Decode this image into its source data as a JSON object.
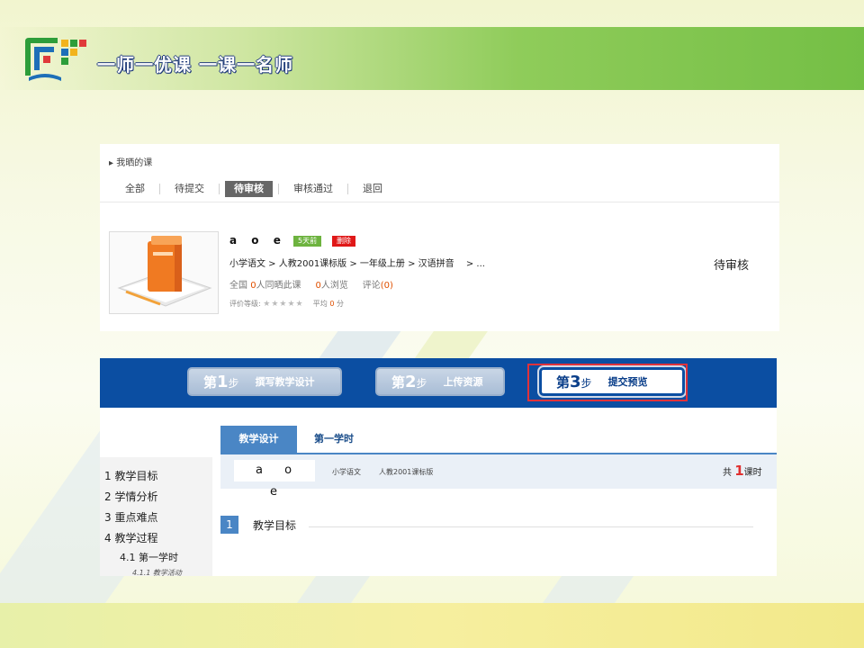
{
  "brand": {
    "title": "一师一优课 一课一名师"
  },
  "my_courses": {
    "title": "▸ 我晒的课",
    "tabs": [
      {
        "label": "全部"
      },
      {
        "label": "待提交"
      },
      {
        "label": "待审核"
      },
      {
        "label": "审核通过"
      },
      {
        "label": "退回"
      }
    ],
    "active_tab": "待审核",
    "course": {
      "name": "a o e",
      "badge_time": "5天前",
      "badge_delete": "删除",
      "path": "小学语文 > 人教2001课标版 > 一年级上册 > 汉语拼音　 > ...",
      "stats_prefix": "全国",
      "stats_count": "0",
      "stats_label": "人同晒此课",
      "views_count": "0",
      "views_label": "人浏览",
      "comments_label": "评论",
      "comments_count": "(0)",
      "rating_label": "评价等级:",
      "stars": "★★★★★",
      "avg_label": "平均",
      "avg_value": "0",
      "avg_unit": "分",
      "status": "待审核"
    }
  },
  "steps": [
    {
      "prefix": "第",
      "num": "1",
      "suffix": "步",
      "label": "撰写教学设计"
    },
    {
      "prefix": "第",
      "num": "2",
      "suffix": "步",
      "label": "上传资源"
    },
    {
      "prefix": "第",
      "num": "3",
      "suffix": "步",
      "label": "提交预览"
    }
  ],
  "preview": {
    "tab_design": "教学设计",
    "tab_lesson": "第一学时",
    "course_name": "a o e",
    "subject": "小学语文",
    "edition": "人教2001课标版",
    "total_prefix": "共",
    "total_count": "1",
    "total_suffix": "课时",
    "nav": [
      {
        "label": "1 教学目标"
      },
      {
        "label": "2 学情分析"
      },
      {
        "label": "3 重点难点"
      },
      {
        "label": "4 教学过程"
      },
      {
        "label": "4.1 第一学时"
      },
      {
        "label": "4.1.1 教学活动"
      }
    ],
    "section_num": "1",
    "section_title": "教学目标"
  },
  "colors": {
    "header_green": "#74bf45",
    "steps_blue": "#0b4ea2",
    "tab_blue": "#4a86c5",
    "highlight_red": "#e0323a",
    "badge_green": "#6db33f",
    "badge_red": "#e01818"
  }
}
